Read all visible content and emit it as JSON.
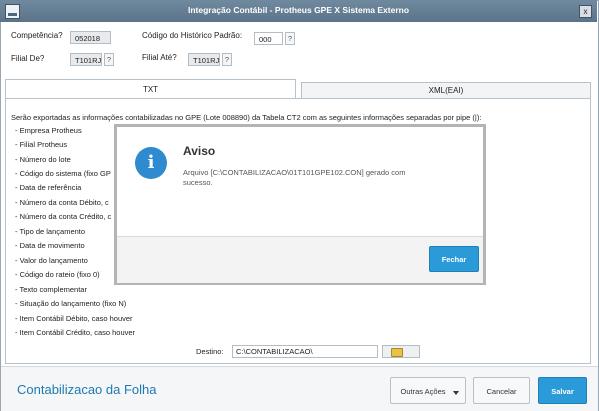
{
  "window": {
    "title": "Integração Contábil - Protheus GPE X Sistema Externo",
    "close": "x"
  },
  "form": {
    "competencia_label": "Competência?",
    "competencia_value": "052018",
    "historico_label": "Código do Histórico Padrão:",
    "historico_value": "000",
    "filial_de_label": "Filial De?",
    "filial_de_value": "T101RJ",
    "filial_ate_label": "Filial Até?",
    "filial_ate_value": "T101RJ",
    "help": "?"
  },
  "tabs": [
    {
      "label": "TXT",
      "active": true
    },
    {
      "label": "XML(EAI)",
      "active": false
    }
  ],
  "content": {
    "intro": "Serão exportadas as informações contabilizadas no GPE (Lote 008890) da Tabela CT2 com as seguintes informações separadas por pipe (|):",
    "items": [
      "- Empresa Protheus",
      "- Filial Protheus",
      "- Número do lote",
      "- Código do sistema (fixo GP",
      "- Data de referência",
      "- Número da conta Débito, c",
      "- Número da conta Crédito, c",
      "- Tipo de lançamento",
      "- Data de movimento",
      "- Valor do lançamento",
      "- Código do rateio (fixo 0)",
      "- Texto complementar",
      "- Situação do lançamento (fixo N)",
      "- Item Contábil Débito, caso houver",
      "- Item Contábil Crédito, caso houver"
    ],
    "destino_label": "Destino:",
    "destino_value": "C:\\CONTABILIZACAO\\"
  },
  "footer": {
    "title": "Contabilizacao da Folha",
    "outras_acoes": "Outras Ações",
    "cancelar": "Cancelar",
    "salvar": "Salvar"
  },
  "modal": {
    "icon": "i",
    "title": "Aviso",
    "message": "Arquivo [C:\\CONTABILIZACAO\\01T101GPE102.CON] gerado com sucesso.",
    "button": "Fechar"
  },
  "colors": {
    "titlebar": "#5f788d",
    "accent": "#2b9ad9",
    "footer_title": "#1d7ab0"
  }
}
